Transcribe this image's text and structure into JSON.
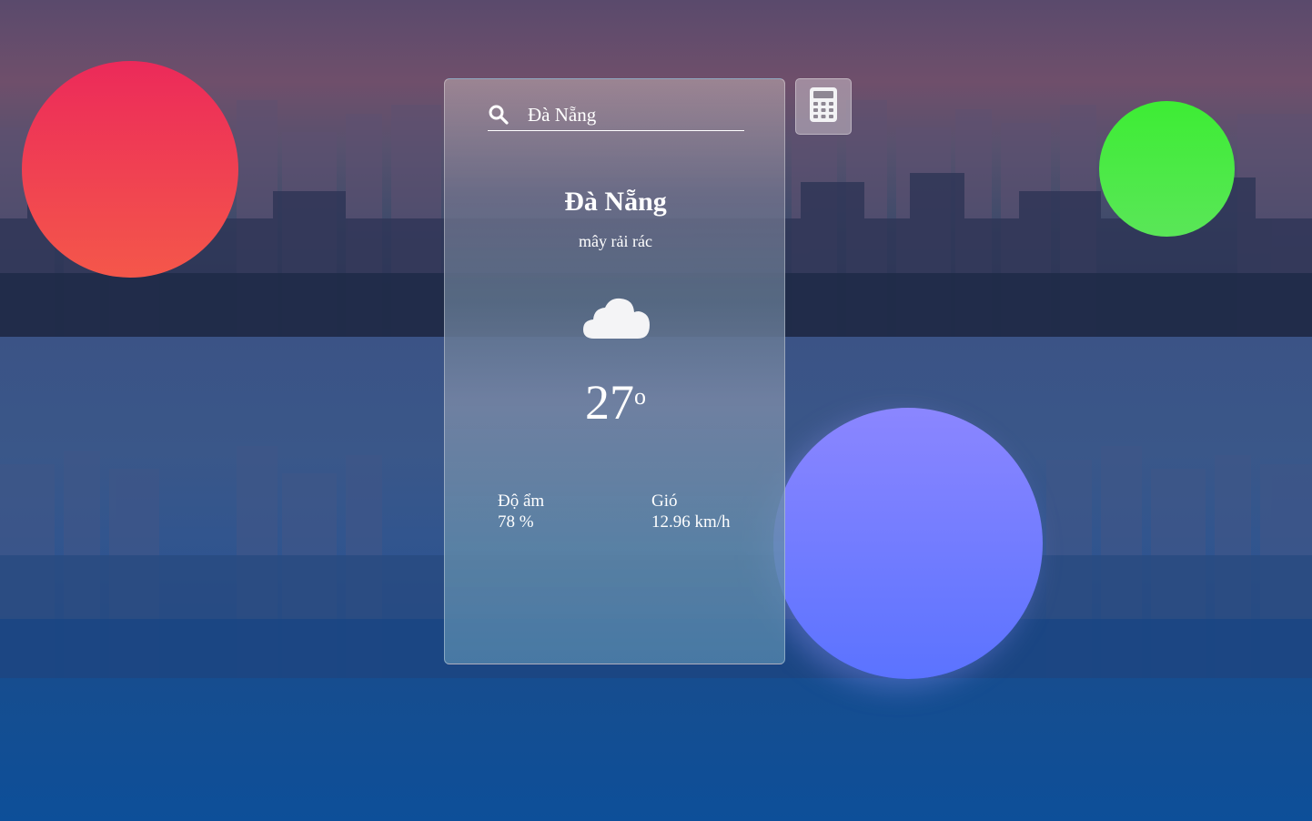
{
  "search": {
    "value": "Đà Nẵng",
    "placeholder": "Đà Nẵng"
  },
  "weather": {
    "city": "Đà Nẵng",
    "description": "mây rải rác",
    "icon": "cloud-icon",
    "temperature": "27",
    "degree_symbol": "o",
    "humidity_label": "Độ ẩm",
    "humidity_value": "78 %",
    "wind_label": "Gió",
    "wind_value": "12.96 km/h"
  },
  "toolbar": {
    "calculator_icon": "calculator-icon"
  },
  "colors": {
    "orb_red": "#ec2a5a",
    "orb_green": "#3ded34",
    "orb_purple": "#7c7dff",
    "text": "#ffffff"
  }
}
